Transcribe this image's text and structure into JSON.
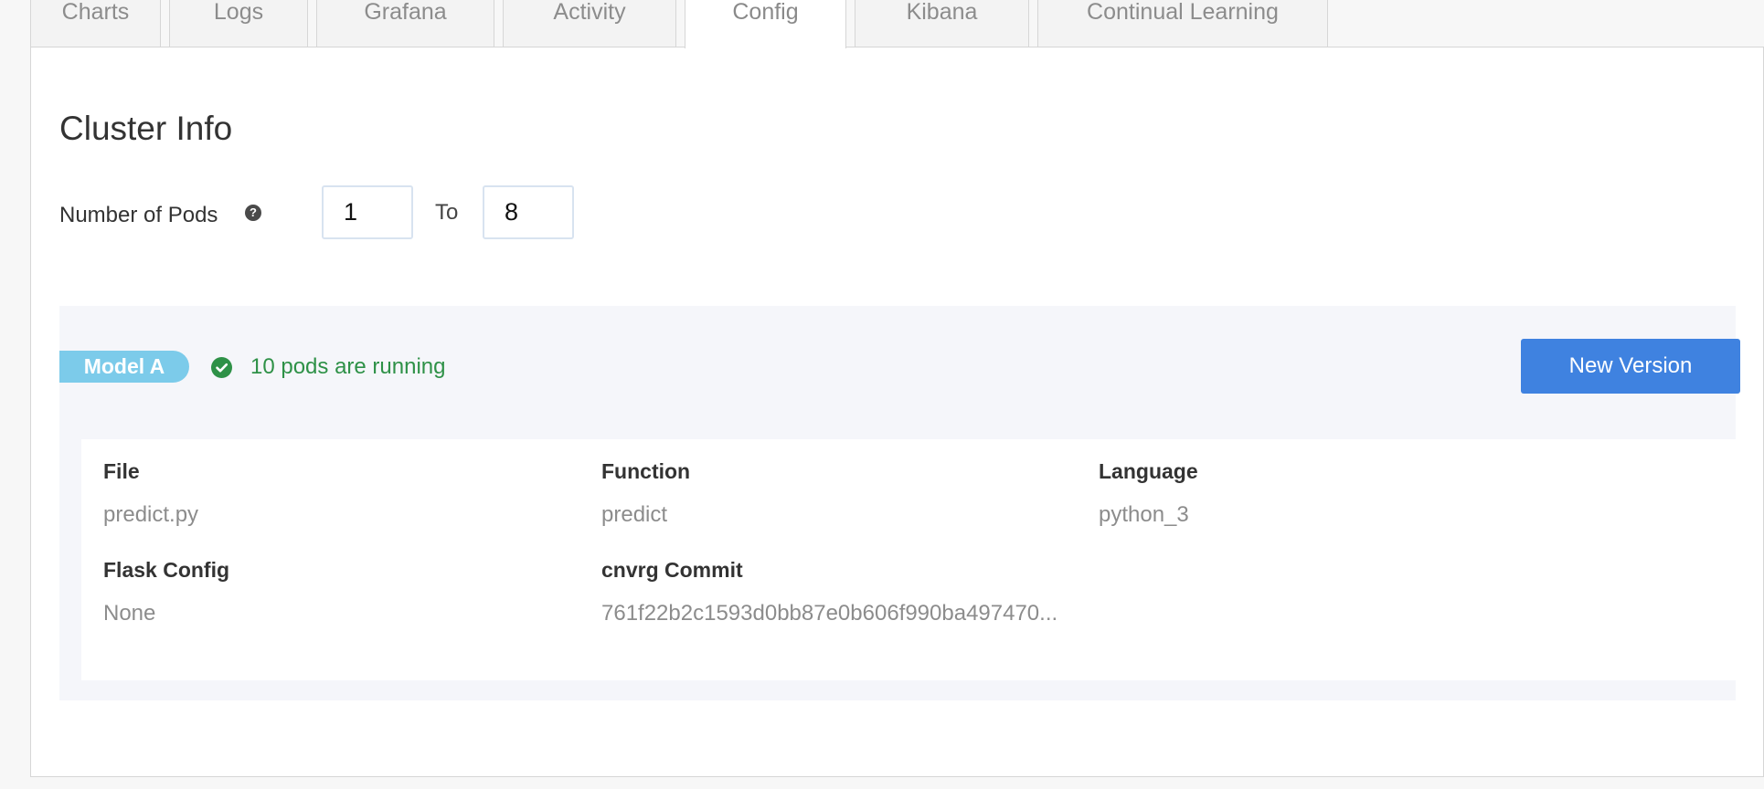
{
  "tabs": [
    {
      "label": "Charts",
      "active": false
    },
    {
      "label": "Logs",
      "active": false
    },
    {
      "label": "Grafana",
      "active": false
    },
    {
      "label": "Activity",
      "active": false
    },
    {
      "label": "Config",
      "active": true
    },
    {
      "label": "Kibana",
      "active": false
    },
    {
      "label": "Continual Learning",
      "active": false
    }
  ],
  "cluster": {
    "title": "Cluster Info",
    "pods_label": "Number of Pods",
    "help_icon": "question-circle-icon",
    "min_pods": "1",
    "to_label": "To",
    "max_pods": "8"
  },
  "model": {
    "badge": "Model A",
    "status_icon": "check-circle-icon",
    "status_text": "10 pods are running",
    "status_color": "#2e9147",
    "new_version_label": "New Version",
    "fields": {
      "file": {
        "label": "File",
        "value": "predict.py"
      },
      "function": {
        "label": "Function",
        "value": "predict"
      },
      "language": {
        "label": "Language",
        "value": "python_3"
      },
      "flask_config": {
        "label": "Flask Config",
        "value": "None"
      },
      "commit": {
        "label": "cnvrg Commit",
        "value": "761f22b2c1593d0bb87e0b606f990ba497470..."
      }
    }
  },
  "colors": {
    "accent": "#3f82e0",
    "badge": "#7ccbea",
    "success": "#2e9147"
  }
}
